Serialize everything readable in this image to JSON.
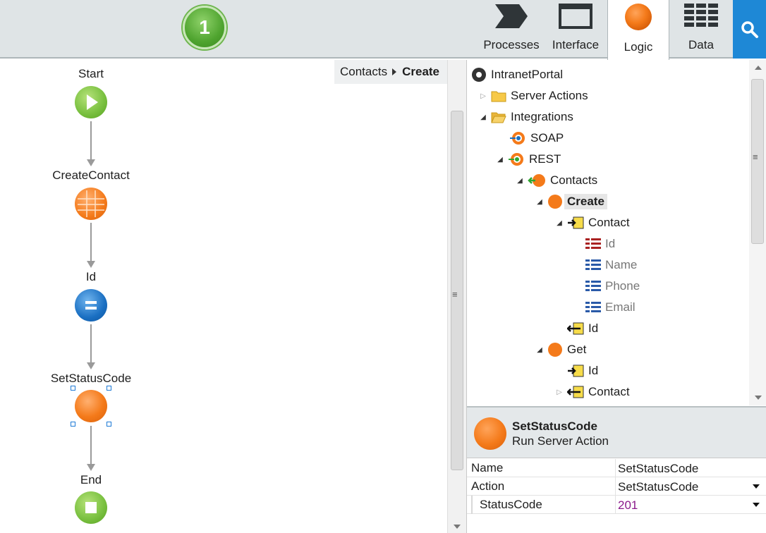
{
  "toolbar": {
    "publish_count": "1",
    "tabs": [
      {
        "label": "Processes",
        "icon": "process-chevron-icon"
      },
      {
        "label": "Interface",
        "icon": "window-icon"
      },
      {
        "label": "Logic",
        "icon": "orange-circle-icon",
        "active": true
      },
      {
        "label": "Data",
        "icon": "table-grid-icon"
      }
    ],
    "search_icon": "search-icon"
  },
  "breadcrumb": {
    "parent": "Contacts",
    "current": "Create"
  },
  "flow": {
    "nodes": [
      {
        "label": "Start",
        "type": "start"
      },
      {
        "label": "CreateContact",
        "type": "entity-action"
      },
      {
        "label": "Id",
        "type": "assign"
      },
      {
        "label": "SetStatusCode",
        "type": "server-action",
        "selected": true
      },
      {
        "label": "End",
        "type": "end"
      }
    ]
  },
  "tree": {
    "root": "IntranetPortal",
    "server_actions": "Server Actions",
    "integrations": "Integrations",
    "soap": "SOAP",
    "rest": "REST",
    "contacts": "Contacts",
    "create": "Create",
    "contact_param": "Contact",
    "attr_id": "Id",
    "attr_name": "Name",
    "attr_phone": "Phone",
    "attr_email": "Email",
    "out_id": "Id",
    "get": "Get",
    "get_id": "Id",
    "get_contact": "Contact"
  },
  "properties": {
    "title": "SetStatusCode",
    "subtitle": "Run Server Action",
    "rows": [
      {
        "key": "Name",
        "value": "SetStatusCode"
      },
      {
        "key": "Action",
        "value": "SetStatusCode"
      },
      {
        "key": "StatusCode",
        "value": "201"
      }
    ]
  },
  "colors": {
    "toolbar_bg": "#dfe4e6",
    "accent_blue": "#1e88d6",
    "server_action_orange": "#f47a1a",
    "start_green": "#7cc242",
    "assign_blue": "#1a6fc2",
    "status_value_purple": "#8b1a8b"
  }
}
